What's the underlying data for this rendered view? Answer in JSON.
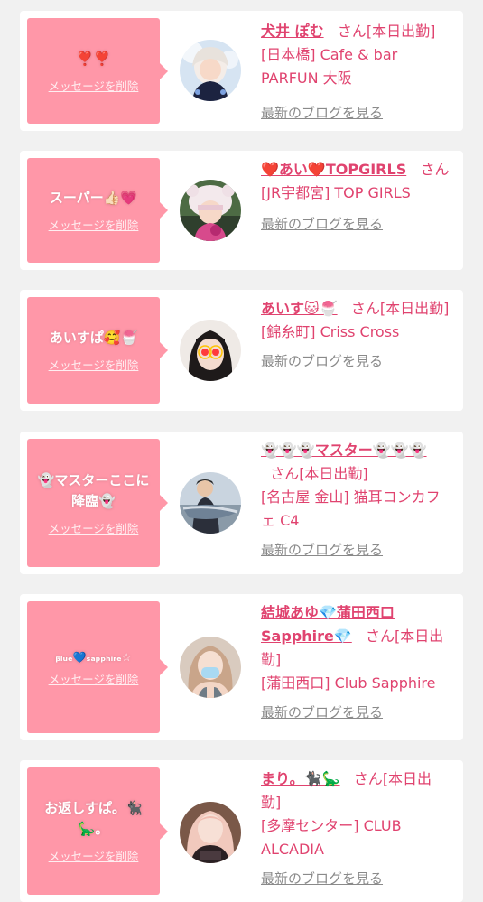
{
  "delete_label": "メッセージを削除",
  "blog_label": "最新のブログを見る",
  "san_label": "さん",
  "cards": [
    {
      "message": "❣️❣️",
      "name": "犬井 ぽむ",
      "status": "[本日出勤]",
      "shop": "[日本橋] Cafe & bar PARFUN 大阪"
    },
    {
      "message": "スーパー👍🏻💗",
      "name": "❤️あい❤️TOPGIRLS",
      "status": "",
      "shop": "[JR宇都宮] TOP GIRLS"
    },
    {
      "message": "あいすぱ🥰🍧",
      "name": "あいす🐱🍧",
      "status": "[本日出勤]",
      "shop": "[錦糸町] Criss Cross"
    },
    {
      "message": "👻マスターここに降臨👻",
      "name": "👻👻👻マスター👻👻👻",
      "status": "[本日出勤]",
      "shop": "[名古屋 金山] 猫耳コンカフェ C4"
    },
    {
      "message": "ᵦₗᵤₑ💙ₛₐₚₚₕᵢᵣₑ☆",
      "name": "結城あゆ💎蒲田西口Sapphire💎",
      "status": "[本日出勤]",
      "shop": "[蒲田西口] Club Sapphire"
    },
    {
      "message": "お返しすぱ。🐈‍⬛🦕。",
      "name": "まり。🐈‍⬛🦕",
      "status": "[本日出勤]",
      "shop": "[多摩センター] CLUB ALCADIA"
    }
  ]
}
